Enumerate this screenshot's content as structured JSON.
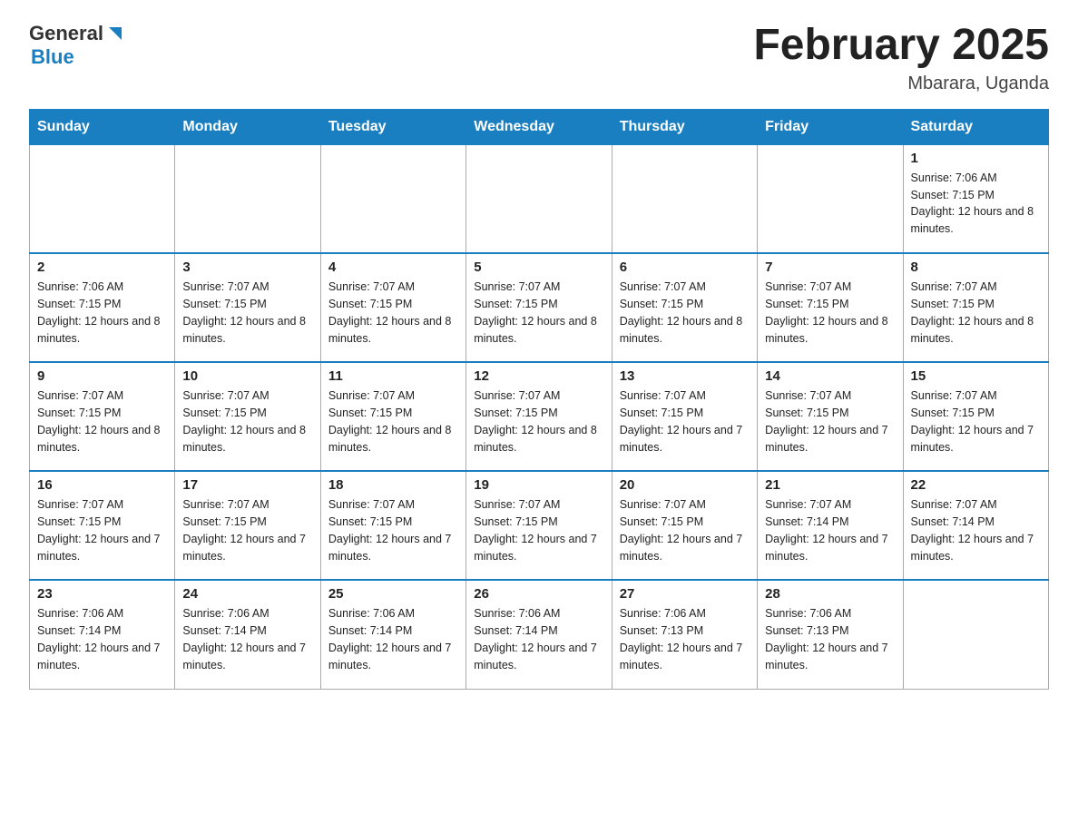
{
  "logo": {
    "general": "General",
    "blue": "Blue"
  },
  "header": {
    "title": "February 2025",
    "location": "Mbarara, Uganda"
  },
  "days_of_week": [
    "Sunday",
    "Monday",
    "Tuesday",
    "Wednesday",
    "Thursday",
    "Friday",
    "Saturday"
  ],
  "weeks": [
    [
      {
        "day": "",
        "sunrise": "",
        "sunset": "",
        "daylight": ""
      },
      {
        "day": "",
        "sunrise": "",
        "sunset": "",
        "daylight": ""
      },
      {
        "day": "",
        "sunrise": "",
        "sunset": "",
        "daylight": ""
      },
      {
        "day": "",
        "sunrise": "",
        "sunset": "",
        "daylight": ""
      },
      {
        "day": "",
        "sunrise": "",
        "sunset": "",
        "daylight": ""
      },
      {
        "day": "",
        "sunrise": "",
        "sunset": "",
        "daylight": ""
      },
      {
        "day": "1",
        "sunrise": "Sunrise: 7:06 AM",
        "sunset": "Sunset: 7:15 PM",
        "daylight": "Daylight: 12 hours and 8 minutes."
      }
    ],
    [
      {
        "day": "2",
        "sunrise": "Sunrise: 7:06 AM",
        "sunset": "Sunset: 7:15 PM",
        "daylight": "Daylight: 12 hours and 8 minutes."
      },
      {
        "day": "3",
        "sunrise": "Sunrise: 7:07 AM",
        "sunset": "Sunset: 7:15 PM",
        "daylight": "Daylight: 12 hours and 8 minutes."
      },
      {
        "day": "4",
        "sunrise": "Sunrise: 7:07 AM",
        "sunset": "Sunset: 7:15 PM",
        "daylight": "Daylight: 12 hours and 8 minutes."
      },
      {
        "day": "5",
        "sunrise": "Sunrise: 7:07 AM",
        "sunset": "Sunset: 7:15 PM",
        "daylight": "Daylight: 12 hours and 8 minutes."
      },
      {
        "day": "6",
        "sunrise": "Sunrise: 7:07 AM",
        "sunset": "Sunset: 7:15 PM",
        "daylight": "Daylight: 12 hours and 8 minutes."
      },
      {
        "day": "7",
        "sunrise": "Sunrise: 7:07 AM",
        "sunset": "Sunset: 7:15 PM",
        "daylight": "Daylight: 12 hours and 8 minutes."
      },
      {
        "day": "8",
        "sunrise": "Sunrise: 7:07 AM",
        "sunset": "Sunset: 7:15 PM",
        "daylight": "Daylight: 12 hours and 8 minutes."
      }
    ],
    [
      {
        "day": "9",
        "sunrise": "Sunrise: 7:07 AM",
        "sunset": "Sunset: 7:15 PM",
        "daylight": "Daylight: 12 hours and 8 minutes."
      },
      {
        "day": "10",
        "sunrise": "Sunrise: 7:07 AM",
        "sunset": "Sunset: 7:15 PM",
        "daylight": "Daylight: 12 hours and 8 minutes."
      },
      {
        "day": "11",
        "sunrise": "Sunrise: 7:07 AM",
        "sunset": "Sunset: 7:15 PM",
        "daylight": "Daylight: 12 hours and 8 minutes."
      },
      {
        "day": "12",
        "sunrise": "Sunrise: 7:07 AM",
        "sunset": "Sunset: 7:15 PM",
        "daylight": "Daylight: 12 hours and 8 minutes."
      },
      {
        "day": "13",
        "sunrise": "Sunrise: 7:07 AM",
        "sunset": "Sunset: 7:15 PM",
        "daylight": "Daylight: 12 hours and 7 minutes."
      },
      {
        "day": "14",
        "sunrise": "Sunrise: 7:07 AM",
        "sunset": "Sunset: 7:15 PM",
        "daylight": "Daylight: 12 hours and 7 minutes."
      },
      {
        "day": "15",
        "sunrise": "Sunrise: 7:07 AM",
        "sunset": "Sunset: 7:15 PM",
        "daylight": "Daylight: 12 hours and 7 minutes."
      }
    ],
    [
      {
        "day": "16",
        "sunrise": "Sunrise: 7:07 AM",
        "sunset": "Sunset: 7:15 PM",
        "daylight": "Daylight: 12 hours and 7 minutes."
      },
      {
        "day": "17",
        "sunrise": "Sunrise: 7:07 AM",
        "sunset": "Sunset: 7:15 PM",
        "daylight": "Daylight: 12 hours and 7 minutes."
      },
      {
        "day": "18",
        "sunrise": "Sunrise: 7:07 AM",
        "sunset": "Sunset: 7:15 PM",
        "daylight": "Daylight: 12 hours and 7 minutes."
      },
      {
        "day": "19",
        "sunrise": "Sunrise: 7:07 AM",
        "sunset": "Sunset: 7:15 PM",
        "daylight": "Daylight: 12 hours and 7 minutes."
      },
      {
        "day": "20",
        "sunrise": "Sunrise: 7:07 AM",
        "sunset": "Sunset: 7:15 PM",
        "daylight": "Daylight: 12 hours and 7 minutes."
      },
      {
        "day": "21",
        "sunrise": "Sunrise: 7:07 AM",
        "sunset": "Sunset: 7:14 PM",
        "daylight": "Daylight: 12 hours and 7 minutes."
      },
      {
        "day": "22",
        "sunrise": "Sunrise: 7:07 AM",
        "sunset": "Sunset: 7:14 PM",
        "daylight": "Daylight: 12 hours and 7 minutes."
      }
    ],
    [
      {
        "day": "23",
        "sunrise": "Sunrise: 7:06 AM",
        "sunset": "Sunset: 7:14 PM",
        "daylight": "Daylight: 12 hours and 7 minutes."
      },
      {
        "day": "24",
        "sunrise": "Sunrise: 7:06 AM",
        "sunset": "Sunset: 7:14 PM",
        "daylight": "Daylight: 12 hours and 7 minutes."
      },
      {
        "day": "25",
        "sunrise": "Sunrise: 7:06 AM",
        "sunset": "Sunset: 7:14 PM",
        "daylight": "Daylight: 12 hours and 7 minutes."
      },
      {
        "day": "26",
        "sunrise": "Sunrise: 7:06 AM",
        "sunset": "Sunset: 7:14 PM",
        "daylight": "Daylight: 12 hours and 7 minutes."
      },
      {
        "day": "27",
        "sunrise": "Sunrise: 7:06 AM",
        "sunset": "Sunset: 7:13 PM",
        "daylight": "Daylight: 12 hours and 7 minutes."
      },
      {
        "day": "28",
        "sunrise": "Sunrise: 7:06 AM",
        "sunset": "Sunset: 7:13 PM",
        "daylight": "Daylight: 12 hours and 7 minutes."
      },
      {
        "day": "",
        "sunrise": "",
        "sunset": "",
        "daylight": ""
      }
    ]
  ]
}
